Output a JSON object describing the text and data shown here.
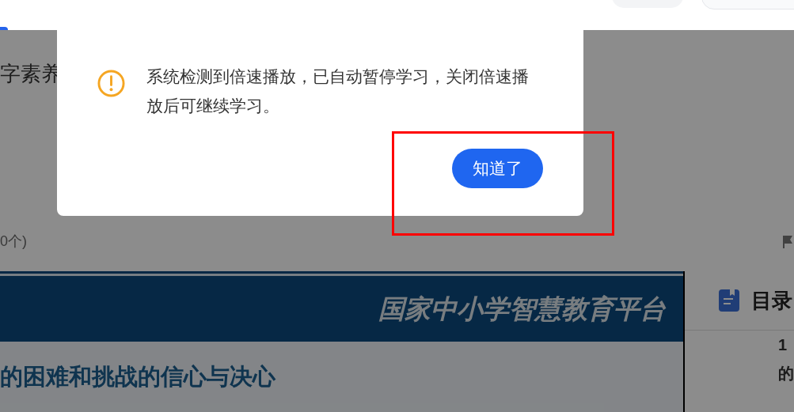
{
  "page": {
    "title": "字素养",
    "count": "0个)",
    "video": {
      "banner": "国家中小学智慧教育平台",
      "subtitle": "的困难和挑战的信心与决心"
    },
    "toc": {
      "title": "目录",
      "items": [
        "1",
        "的"
      ]
    }
  },
  "dialog": {
    "message": "系统检测到倍速播放，已自动暂停学习，关闭倍速播放后可继续学习。",
    "button": "知道了"
  }
}
